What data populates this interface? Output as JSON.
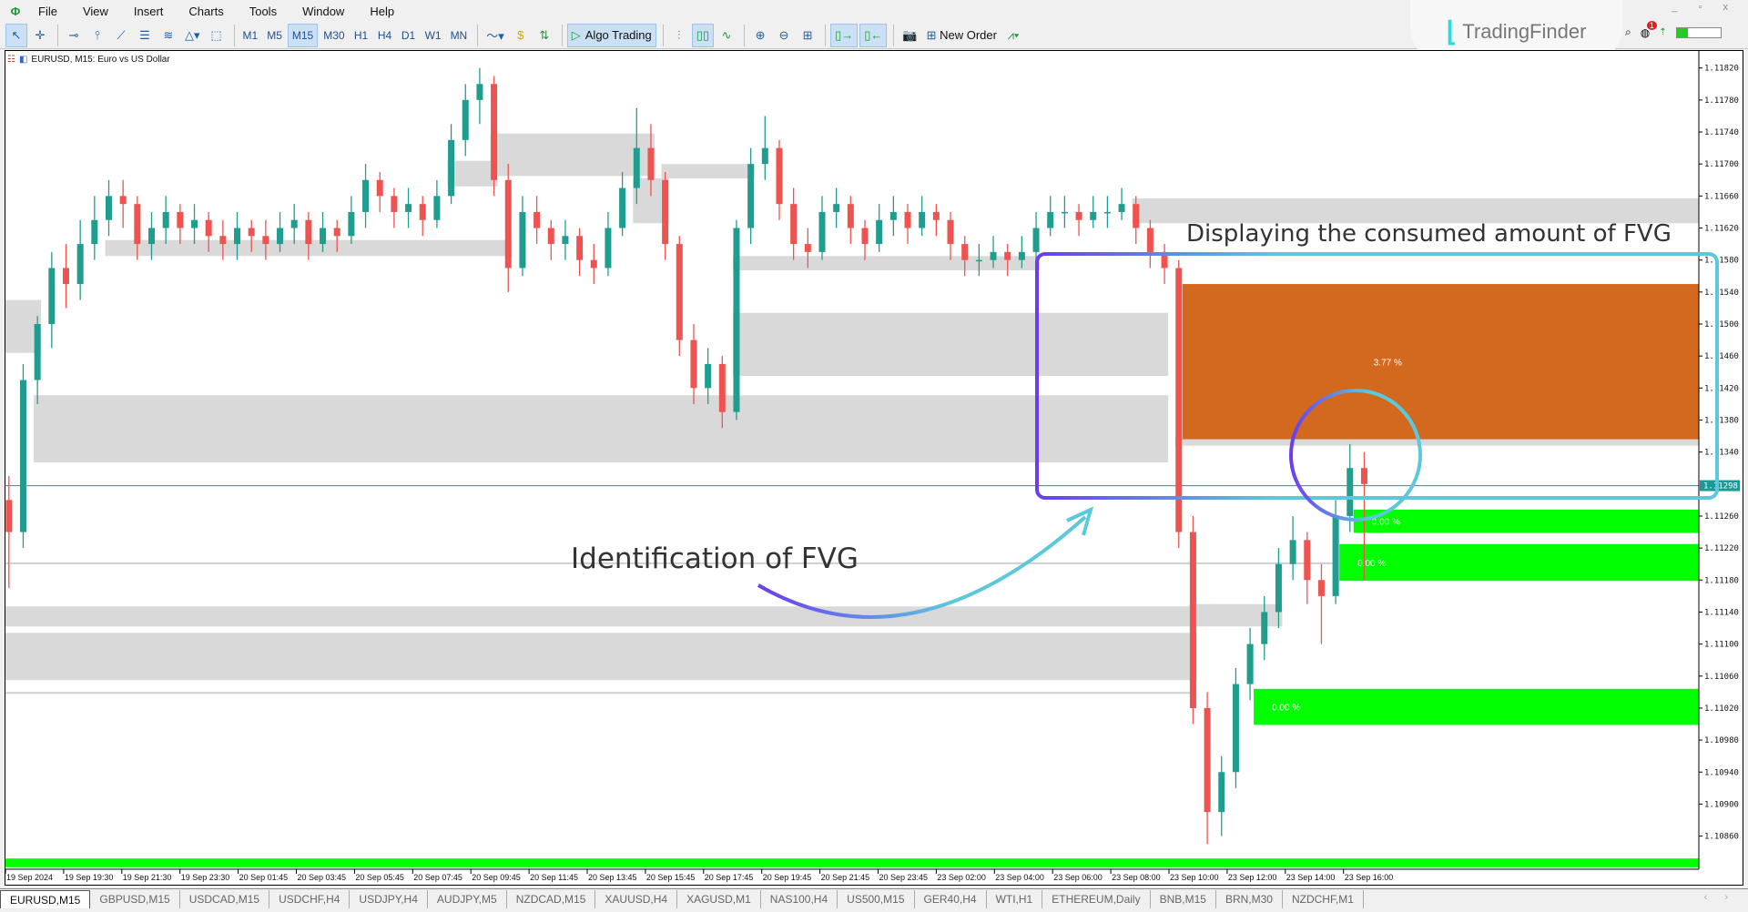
{
  "menu": {
    "items": [
      "File",
      "View",
      "Insert",
      "Charts",
      "Tools",
      "Window",
      "Help"
    ]
  },
  "toolbar": {
    "timeframes": [
      "M1",
      "M5",
      "M15",
      "M30",
      "H1",
      "H4",
      "D1",
      "W1",
      "MN"
    ],
    "active_timeframe": "M15",
    "algo_trading": "Algo Trading",
    "new_order": "New Order"
  },
  "logo": {
    "text": "TradingFinder"
  },
  "notifications": {
    "count": "1"
  },
  "chart": {
    "title": "EURUSD, M15:  Euro vs US Dollar",
    "current_price": "1.11298"
  },
  "annotations": {
    "consumed": "Displaying the consumed amount of FVG",
    "identification": "Identification of FVG"
  },
  "tabs": [
    "EURUSD,M15",
    "GBPUSD,M15",
    "USDCAD,M15",
    "USDCHF,H4",
    "USDJPY,H4",
    "AUDJPY,M5",
    "NZDCAD,M15",
    "XAUUSD,H4",
    "XAGUSD,M1",
    "NAS100,H4",
    "US500,M15",
    "GER40,H4",
    "WTI,H1",
    "ETHEREUM,Daily",
    "BNB,M15",
    "BRN,M30",
    "NZDCHF,M1"
  ],
  "active_tab": "EURUSD,M15",
  "colors": {
    "bull": "#1f9e8f",
    "bear": "#ef5350",
    "zone": "#d9d9d9",
    "fvg_consumed": "#d2691e",
    "fvg_fresh": "#00ff00",
    "price_line": "#1a9a96",
    "annotation_start": "#6a3df0",
    "annotation_end": "#5bc8dc"
  },
  "chart_data": {
    "type": "candlestick",
    "symbol": "EURUSD",
    "timeframe": "M15",
    "ylim": [
      1.1082,
      1.1184
    ],
    "yticks": [
      "1.11820",
      "1.11780",
      "1.11740",
      "1.11700",
      "1.11660",
      "1.11620",
      "1.11580",
      "1.11540",
      "1.11500",
      "1.11460",
      "1.11420",
      "1.11380",
      "1.11340",
      "1.11260",
      "1.11220",
      "1.11180",
      "1.11140",
      "1.11100",
      "1.11060",
      "1.11020",
      "1.10980",
      "1.10940",
      "1.10900",
      "1.10860"
    ],
    "xticks": [
      "19 Sep 2024",
      "19 Sep 19:30",
      "19 Sep 21:30",
      "19 Sep 23:30",
      "20 Sep 01:45",
      "20 Sep 03:45",
      "20 Sep 05:45",
      "20 Sep 07:45",
      "20 Sep 09:45",
      "20 Sep 11:45",
      "20 Sep 13:45",
      "20 Sep 15:45",
      "20 Sep 17:45",
      "20 Sep 19:45",
      "20 Sep 21:45",
      "20 Sep 23:45",
      "23 Sep 02:00",
      "23 Sep 04:00",
      "23 Sep 06:00",
      "23 Sep 08:00",
      "23 Sep 10:00",
      "23 Sep 12:00",
      "23 Sep 14:00",
      "23 Sep 16:00"
    ],
    "ohlc": [
      [
        1.1128,
        1.1131,
        1.1117,
        1.1124
      ],
      [
        1.1124,
        1.1145,
        1.1122,
        1.1143
      ],
      [
        1.1143,
        1.1151,
        1.114,
        1.115
      ],
      [
        1.115,
        1.1159,
        1.1147,
        1.1157
      ],
      [
        1.1157,
        1.116,
        1.1152,
        1.1155
      ],
      [
        1.1155,
        1.1163,
        1.1153,
        1.116
      ],
      [
        1.116,
        1.1166,
        1.1158,
        1.1163
      ],
      [
        1.1163,
        1.1168,
        1.1161,
        1.1166
      ],
      [
        1.1166,
        1.1168,
        1.1162,
        1.1165
      ],
      [
        1.1165,
        1.1166,
        1.1158,
        1.116
      ],
      [
        1.116,
        1.1164,
        1.1158,
        1.1162
      ],
      [
        1.1162,
        1.1166,
        1.116,
        1.1164
      ],
      [
        1.1164,
        1.1165,
        1.116,
        1.1162
      ],
      [
        1.1162,
        1.1165,
        1.116,
        1.1163
      ],
      [
        1.1163,
        1.1164,
        1.1159,
        1.1161
      ],
      [
        1.1161,
        1.1163,
        1.1158,
        1.116
      ],
      [
        1.116,
        1.1164,
        1.1158,
        1.1162
      ],
      [
        1.1162,
        1.1163,
        1.1159,
        1.1161
      ],
      [
        1.1161,
        1.1163,
        1.1158,
        1.116
      ],
      [
        1.116,
        1.1164,
        1.1159,
        1.1162
      ],
      [
        1.1162,
        1.1165,
        1.116,
        1.1163
      ],
      [
        1.1163,
        1.1164,
        1.1158,
        1.116
      ],
      [
        1.116,
        1.1164,
        1.1159,
        1.1162
      ],
      [
        1.1162,
        1.1163,
        1.1159,
        1.1161
      ],
      [
        1.1161,
        1.1166,
        1.116,
        1.1164
      ],
      [
        1.1164,
        1.117,
        1.1162,
        1.1168
      ],
      [
        1.1168,
        1.1169,
        1.1164,
        1.1166
      ],
      [
        1.1166,
        1.1167,
        1.1162,
        1.1164
      ],
      [
        1.1164,
        1.1167,
        1.1162,
        1.1165
      ],
      [
        1.1165,
        1.1166,
        1.1161,
        1.1163
      ],
      [
        1.1163,
        1.1168,
        1.1162,
        1.1166
      ],
      [
        1.1166,
        1.1175,
        1.1165,
        1.1173
      ],
      [
        1.1173,
        1.118,
        1.1171,
        1.1178
      ],
      [
        1.1178,
        1.1182,
        1.1175,
        1.118
      ],
      [
        1.118,
        1.1181,
        1.1166,
        1.1168
      ],
      [
        1.1168,
        1.117,
        1.1154,
        1.1157
      ],
      [
        1.1157,
        1.1166,
        1.1156,
        1.1164
      ],
      [
        1.1164,
        1.1166,
        1.116,
        1.1162
      ],
      [
        1.1162,
        1.1163,
        1.1158,
        1.116
      ],
      [
        1.116,
        1.1163,
        1.1158,
        1.1161
      ],
      [
        1.1161,
        1.1162,
        1.1156,
        1.1158
      ],
      [
        1.1158,
        1.116,
        1.1155,
        1.1157
      ],
      [
        1.1157,
        1.1164,
        1.1156,
        1.1162
      ],
      [
        1.1162,
        1.1169,
        1.1161,
        1.1167
      ],
      [
        1.1167,
        1.1177,
        1.1165,
        1.1172
      ],
      [
        1.1172,
        1.1175,
        1.1166,
        1.1168
      ],
      [
        1.1168,
        1.1169,
        1.1158,
        1.116
      ],
      [
        1.116,
        1.1161,
        1.1146,
        1.1148
      ],
      [
        1.1148,
        1.115,
        1.114,
        1.1142
      ],
      [
        1.1142,
        1.1147,
        1.114,
        1.1145
      ],
      [
        1.1145,
        1.1146,
        1.1137,
        1.1139
      ],
      [
        1.1139,
        1.1163,
        1.1138,
        1.1162
      ],
      [
        1.1162,
        1.1172,
        1.116,
        1.117
      ],
      [
        1.117,
        1.1176,
        1.1168,
        1.1172
      ],
      [
        1.1172,
        1.1173,
        1.1163,
        1.1165
      ],
      [
        1.1165,
        1.1167,
        1.1158,
        1.116
      ],
      [
        1.116,
        1.1162,
        1.1157,
        1.1159
      ],
      [
        1.1159,
        1.1166,
        1.1158,
        1.1164
      ],
      [
        1.1164,
        1.1167,
        1.1162,
        1.1165
      ],
      [
        1.1165,
        1.1166,
        1.116,
        1.1162
      ],
      [
        1.1162,
        1.1163,
        1.1158,
        1.116
      ],
      [
        1.116,
        1.1165,
        1.1159,
        1.1163
      ],
      [
        1.1163,
        1.1166,
        1.1161,
        1.1164
      ],
      [
        1.1164,
        1.1165,
        1.116,
        1.1162
      ],
      [
        1.1162,
        1.1166,
        1.1161,
        1.1164
      ],
      [
        1.1164,
        1.1165,
        1.1161,
        1.1163
      ],
      [
        1.1163,
        1.1164,
        1.1158,
        1.116
      ],
      [
        1.116,
        1.1161,
        1.1156,
        1.1158
      ],
      [
        1.1158,
        1.116,
        1.1156,
        1.1158
      ],
      [
        1.1158,
        1.1161,
        1.1157,
        1.1159
      ],
      [
        1.1159,
        1.116,
        1.1156,
        1.1158
      ],
      [
        1.1158,
        1.1161,
        1.1157,
        1.1159
      ],
      [
        1.1159,
        1.1164,
        1.1158,
        1.1162
      ],
      [
        1.1162,
        1.1166,
        1.1161,
        1.1164
      ],
      [
        1.1164,
        1.1166,
        1.1162,
        1.1164
      ],
      [
        1.1164,
        1.1165,
        1.1161,
        1.1163
      ],
      [
        1.1163,
        1.1166,
        1.1162,
        1.1164
      ],
      [
        1.1164,
        1.1166,
        1.1162,
        1.1164
      ],
      [
        1.1164,
        1.1167,
        1.1163,
        1.1165
      ],
      [
        1.1165,
        1.1166,
        1.116,
        1.1162
      ],
      [
        1.1162,
        1.1163,
        1.1157,
        1.1159
      ],
      [
        1.1159,
        1.116,
        1.1155,
        1.1157
      ],
      [
        1.1157,
        1.1158,
        1.1122,
        1.1124
      ],
      [
        1.1124,
        1.1126,
        1.11,
        1.1102
      ],
      [
        1.1102,
        1.1104,
        1.1085,
        1.1089
      ],
      [
        1.1089,
        1.1096,
        1.1086,
        1.1094
      ],
      [
        1.1094,
        1.1107,
        1.1092,
        1.1105
      ],
      [
        1.1105,
        1.1112,
        1.1103,
        1.111
      ],
      [
        1.111,
        1.1116,
        1.1108,
        1.1114
      ],
      [
        1.1114,
        1.1122,
        1.1112,
        1.112
      ],
      [
        1.112,
        1.1126,
        1.1118,
        1.1123
      ],
      [
        1.1123,
        1.1124,
        1.1115,
        1.1118
      ],
      [
        1.1118,
        1.112,
        1.111,
        1.1116
      ],
      [
        1.1116,
        1.1128,
        1.1115,
        1.1126
      ],
      [
        1.1126,
        1.1135,
        1.1124,
        1.1132
      ],
      [
        1.1132,
        1.1134,
        1.1118,
        1.113
      ]
    ],
    "zones": [
      {
        "top": 1.11738,
        "bottom": 1.11685,
        "from": 34,
        "to": 45
      },
      {
        "top": 1.11704,
        "bottom": 1.11672,
        "from": 31,
        "to": 34
      },
      {
        "top": 1.11605,
        "bottom": 1.11585,
        "from": 7,
        "to": 35
      },
      {
        "top": 1.1153,
        "bottom": 1.11464,
        "from": 0,
        "to": 2
      },
      {
        "top": 1.11411,
        "bottom": 1.11327,
        "from": 2,
        "to": 81
      },
      {
        "top": 1.11147,
        "bottom": 1.11122,
        "from": 0,
        "to": 83
      },
      {
        "top": 1.11114,
        "bottom": 1.11055,
        "from": 0,
        "to": 83
      },
      {
        "top": 1.11657,
        "bottom": 1.11626,
        "from": 79,
        "to": null
      },
      {
        "top": 1.11514,
        "bottom": 1.11435,
        "from": 51,
        "to": 81
      },
      {
        "top": 1.11585,
        "bottom": 1.11567,
        "from": 51,
        "to": 72
      },
      {
        "top": 1.117,
        "bottom": 1.11682,
        "from": 46,
        "to": 52
      },
      {
        "top": 1.11682,
        "bottom": 1.11626,
        "from": 44,
        "to": 46
      },
      {
        "top": 1.1115,
        "bottom": 1.11122,
        "from": 83,
        "to": 89
      },
      {
        "top": 1.11358,
        "bottom": 1.11348,
        "from": 82,
        "to": null
      }
    ],
    "levels": [
      {
        "price": 1.11201,
        "from": 0,
        "to": 93
      },
      {
        "price": 1.11039,
        "from": 0,
        "to": 83
      }
    ],
    "fvg": [
      {
        "top": 1.1155,
        "bottom": 1.11356,
        "from": 82,
        "label": "3.77 %",
        "state": "consumed"
      },
      {
        "top": 1.11268,
        "bottom": 1.11239,
        "from": 94,
        "label": "0.00 %",
        "state": "fresh"
      },
      {
        "top": 1.11225,
        "bottom": 1.11179,
        "from": 93,
        "label": "0.00 %",
        "state": "fresh"
      },
      {
        "top": 1.11044,
        "bottom": 1.10999,
        "from": 87,
        "label": "0.00 %",
        "state": "fresh"
      },
      {
        "top": 1.10832,
        "bottom": 1.10821,
        "from": 0,
        "label": "",
        "state": "fresh"
      }
    ]
  }
}
